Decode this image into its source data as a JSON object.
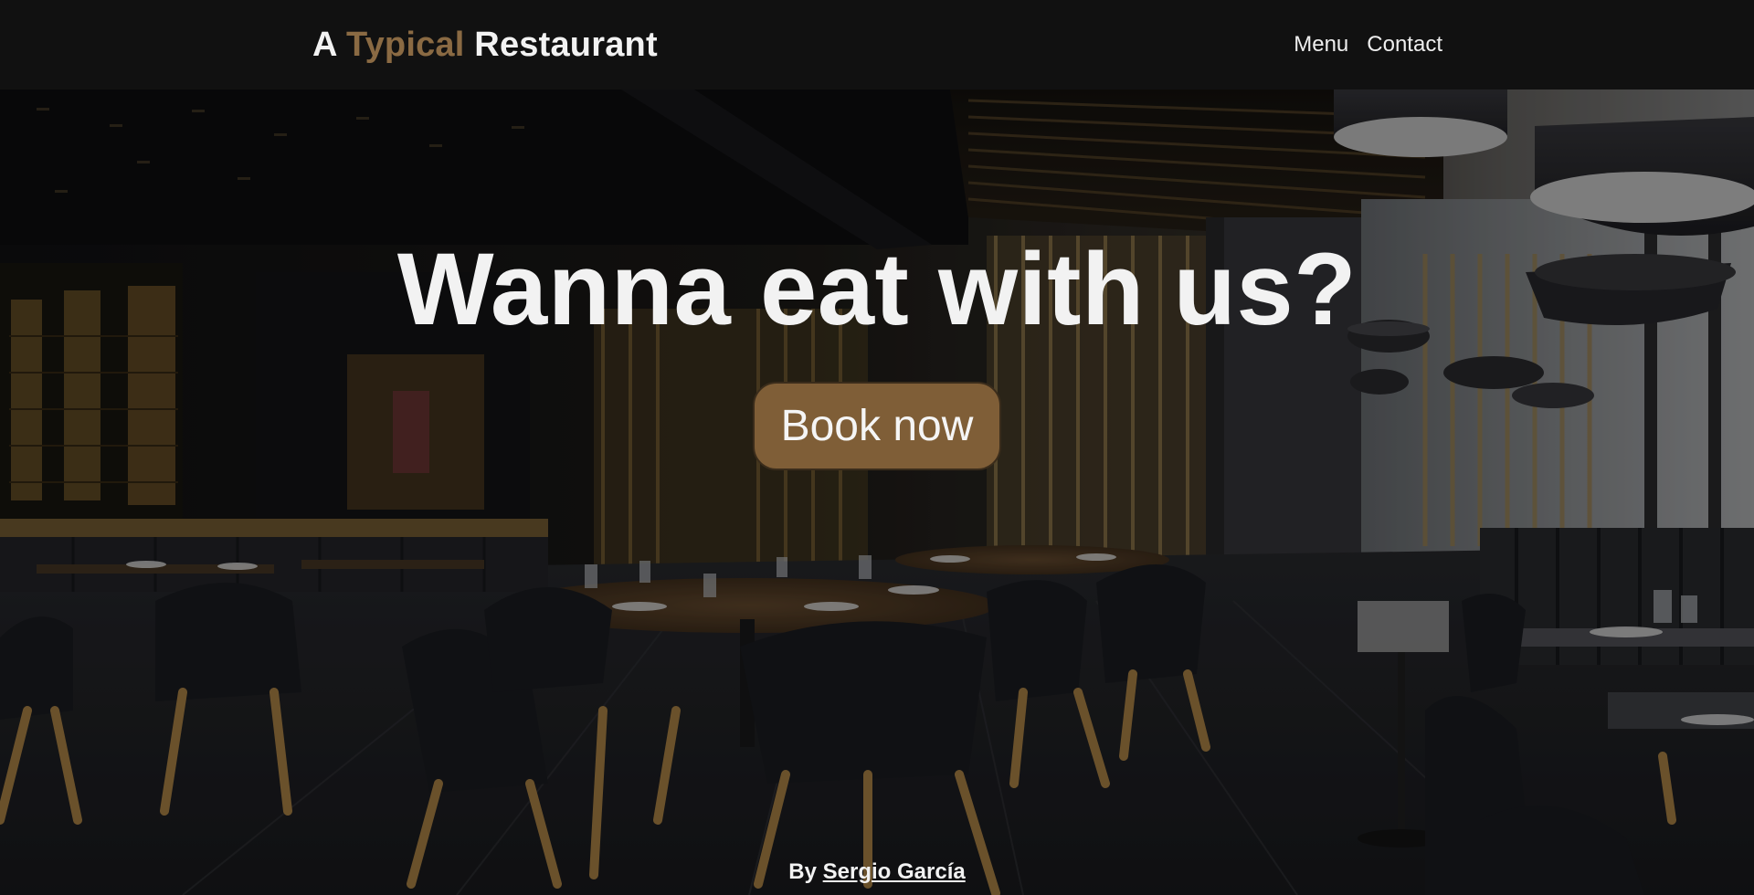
{
  "header": {
    "brand_prefix": "A",
    "brand_accent": "Typical",
    "brand_suffix": "Restaurant",
    "nav": [
      {
        "label": "Menu"
      },
      {
        "label": "Contact"
      }
    ]
  },
  "hero": {
    "headline": "Wanna eat with us?",
    "cta_label": "Book now",
    "background_image": "restaurant-interior-photo"
  },
  "footer": {
    "credit_prefix": "By",
    "credit_author": "Sergio García"
  },
  "colors": {
    "brand_accent": "#8a6a43",
    "button_fill": "#7f5e37",
    "topbar_background": "#111111",
    "text_light": "#f2f2f2"
  }
}
